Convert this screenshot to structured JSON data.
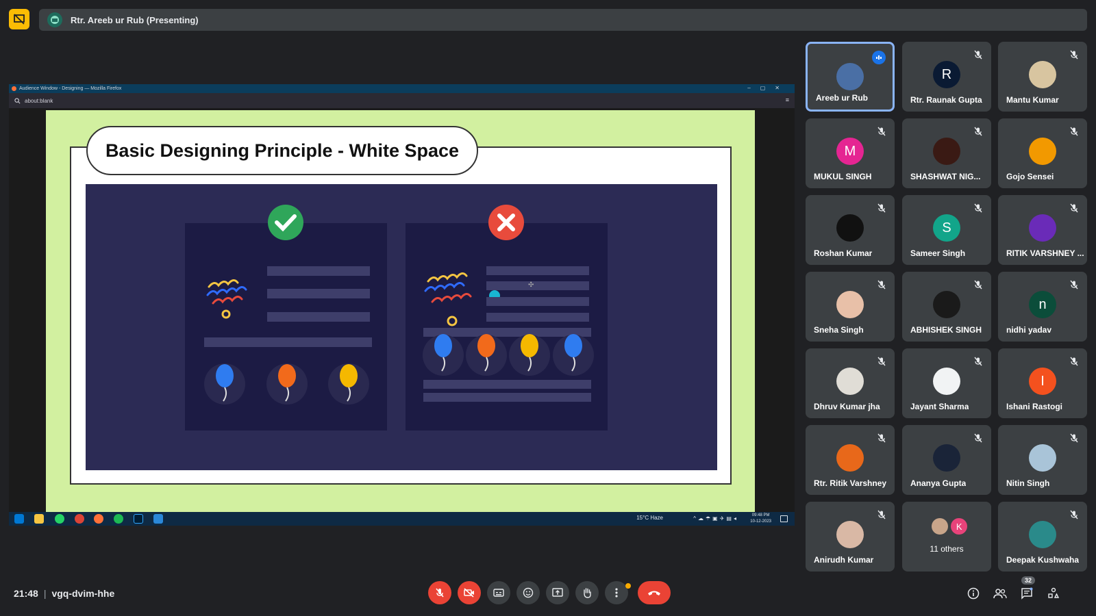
{
  "presenting": {
    "label": "Rtr. Areeb ur Rub (Presenting)"
  },
  "shared_window": {
    "title": "Audience Window - Designing — Mozilla Firefox",
    "window_controls": "–▢✕",
    "url": "about:blank",
    "slide_title": "Basic Designing Principle - White Space",
    "taskbar": {
      "weather": "15°C  Haze",
      "tray_glyphs": "^☁☂▣✈▤◂",
      "time": "09:48 PM",
      "date": "10-12-2023"
    }
  },
  "participants": [
    {
      "name": "Areeb ur Rub",
      "initial": "",
      "color": "#4a6fa5",
      "speaking": true
    },
    {
      "name": "Rtr. Raunak Gupta",
      "initial": "R",
      "color": "#0a1a33"
    },
    {
      "name": "Mantu Kumar",
      "initial": "",
      "color": "#d8c5a0"
    },
    {
      "name": "MUKUL SINGH",
      "initial": "M",
      "color": "#e52592"
    },
    {
      "name": "SHASHWAT NIG...",
      "initial": "",
      "color": "#3a1a14"
    },
    {
      "name": "Gojo Sensei",
      "initial": "",
      "color": "#f29900"
    },
    {
      "name": "Roshan Kumar",
      "initial": "",
      "color": "#111111"
    },
    {
      "name": "Sameer Singh",
      "initial": "S",
      "color": "#12a58a"
    },
    {
      "name": "RITIK VARSHNEY ...",
      "initial": "",
      "color": "#6a2bb8"
    },
    {
      "name": "Sneha Singh",
      "initial": "",
      "color": "#e8c0a8"
    },
    {
      "name": "ABHISHEK SINGH",
      "initial": "",
      "color": "#1a1a1a"
    },
    {
      "name": "nidhi yadav",
      "initial": "n",
      "color": "#0b4d3a"
    },
    {
      "name": "Dhruv Kumar jha",
      "initial": "",
      "color": "#e0ddd6"
    },
    {
      "name": "Jayant Sharma",
      "initial": "",
      "color": "#f1f3f4"
    },
    {
      "name": "Ishani Rastogi",
      "initial": "I",
      "color": "#f4511e"
    },
    {
      "name": "Rtr. Ritik Varshney",
      "initial": "",
      "color": "#e8681a"
    },
    {
      "name": "Ananya Gupta",
      "initial": "",
      "color": "#1a2438"
    },
    {
      "name": "Nitin Singh",
      "initial": "",
      "color": "#a9c4d8"
    },
    {
      "name": "Anirudh Kumar",
      "initial": "",
      "color": "#d9b8a5"
    },
    {
      "name": "11 others",
      "initial": "K",
      "color": "#e8437a",
      "others": true
    },
    {
      "name": "Deepak Kushwaha",
      "initial": "",
      "color": "#2a8a8a"
    }
  ],
  "meeting": {
    "time": "21:48",
    "separator": "|",
    "code": "vgq-dvim-hhe"
  },
  "people_count": "32"
}
